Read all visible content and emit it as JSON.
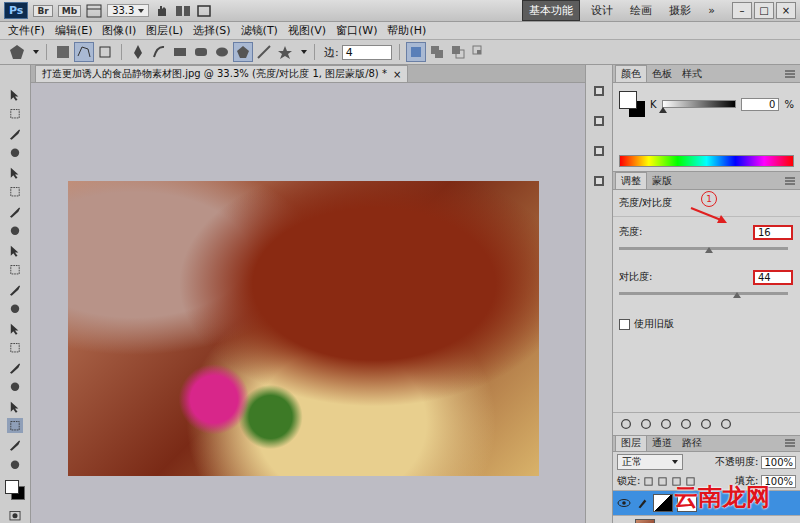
{
  "app_bar": {
    "logo": "Ps",
    "buttons": [
      "Br",
      "Mb"
    ],
    "zoom": "33.3",
    "workspaces": [
      {
        "label": "基本功能",
        "selected": true
      },
      {
        "label": "设计",
        "selected": false
      },
      {
        "label": "绘画",
        "selected": false
      },
      {
        "label": "摄影",
        "selected": false
      }
    ],
    "more": "»",
    "window_controls": [
      "–",
      "□",
      "×"
    ]
  },
  "menu": [
    "文件(F)",
    "编辑(E)",
    "图像(I)",
    "图层(L)",
    "选择(S)",
    "滤镜(T)",
    "视图(V)",
    "窗口(W)",
    "帮助(H)"
  ],
  "options_bar": {
    "sides_label": "边:",
    "sides_value": "4"
  },
  "document": {
    "tab_title": "打造更加诱人的食品静物素材图.jpg @ 33.3% (亮度/对比度 1, 图层蒙版/8) *",
    "close": "×"
  },
  "color_panel": {
    "tabs": [
      {
        "label": "颜色",
        "selected": true
      },
      {
        "label": "色板",
        "selected": false
      },
      {
        "label": "样式",
        "selected": false
      }
    ],
    "channel": "K",
    "level": 0,
    "value": "0",
    "unit": "%"
  },
  "adjustments_panel": {
    "tabs": [
      {
        "label": "调整",
        "selected": true
      },
      {
        "label": "蒙版",
        "selected": false
      }
    ],
    "title": "亮度/对比度",
    "sliders": [
      {
        "label": "亮度:",
        "value": "16",
        "level": 0.53
      },
      {
        "label": "对比度:",
        "value": "44",
        "level": 0.7
      }
    ],
    "legacy": {
      "label": "使用旧版",
      "checked": false
    }
  },
  "annotation": {
    "label": "1"
  },
  "layers_panel": {
    "tabs": [
      {
        "label": "图层",
        "selected": true
      },
      {
        "label": "通道",
        "selected": false
      },
      {
        "label": "路径",
        "selected": false
      }
    ],
    "blend_mode": "正常",
    "opacity_label": "不透明度:",
    "opacity": "100%",
    "lock_label": "锁定:",
    "fill_label": "填充:",
    "fill": "100%"
  },
  "watermark": "云南龙网"
}
